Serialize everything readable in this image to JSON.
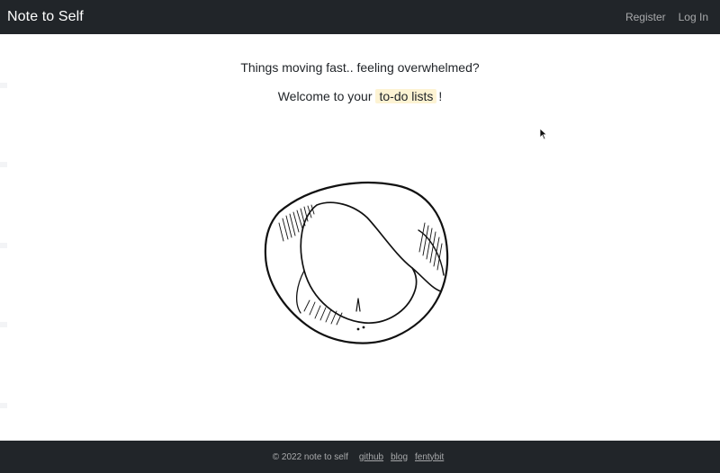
{
  "navbar": {
    "brand": "Note to Self",
    "links": {
      "register": "Register",
      "login": "Log In"
    }
  },
  "hero": {
    "tagline": "Things moving fast.. feeling overwhelmed?",
    "welcome_prefix": "Welcome to your",
    "welcome_link": "to-do lists",
    "welcome_suffix": "!",
    "illustration_icon": "mobius-strip-icon"
  },
  "footer": {
    "copyright": "© 2022 note to self",
    "links": {
      "github": "github",
      "blog": "blog",
      "fentybit": "fentybit"
    }
  },
  "colors": {
    "navbar_bg": "#212529",
    "footer_bg": "#212529",
    "link_highlight": "#fdf3d3"
  }
}
